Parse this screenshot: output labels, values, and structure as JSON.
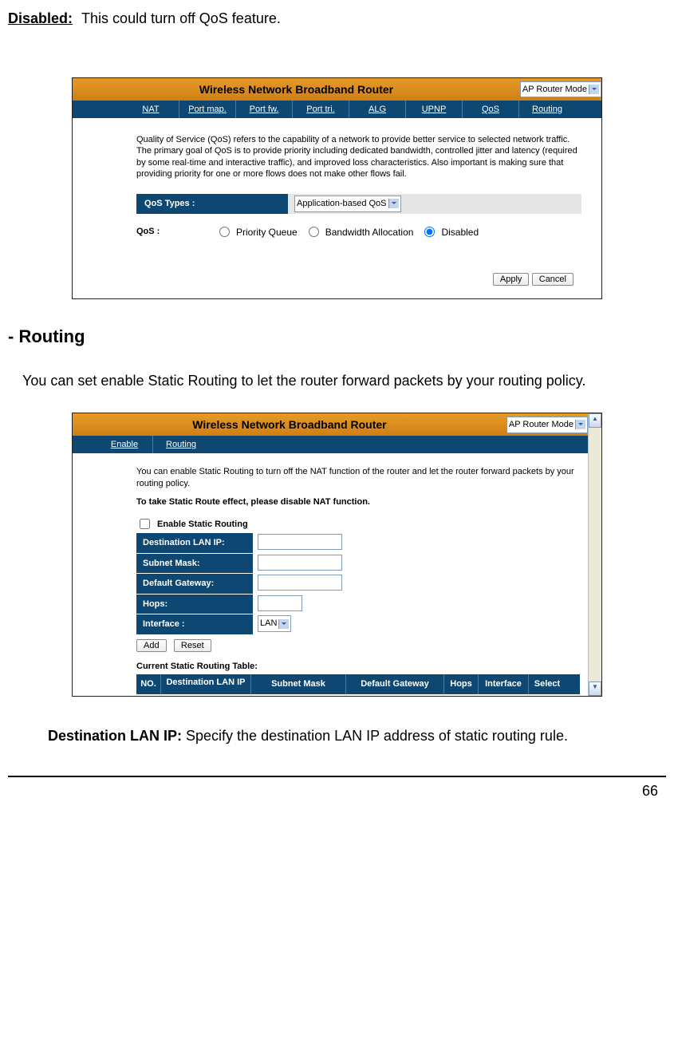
{
  "intro": {
    "disabled_label": "Disabled:",
    "disabled_text": "This could turn off QoS feature."
  },
  "qos": {
    "header_title": "Wireless Network Broadband Router",
    "mode": "AP Router Mode",
    "tabs": [
      "NAT",
      "Port map.",
      "Port fw.",
      "Port tri.",
      "ALG",
      "UPNP",
      "QoS",
      "Routing"
    ],
    "description": "Quality of Service (QoS) refers to the capability of a network to provide better service to selected network traffic. The primary goal of QoS is to provide priority including dedicated bandwidth, controlled jitter and latency (required by some real-time and interactive traffic), and improved loss characteristics. Also important is making sure that providing priority for one or more flows does not make other flows fail.",
    "types_label": "QoS Types :",
    "types_value": "Application-based QoS",
    "qos_label": "QoS :",
    "radio_priority": "Priority Queue",
    "radio_bandwidth": "Bandwidth Allocation",
    "radio_disabled": "Disabled",
    "btn_apply": "Apply",
    "btn_cancel": "Cancel"
  },
  "routing_section": {
    "title": "- Routing",
    "desc": "You can set enable Static Routing to let the router forward packets by your routing policy."
  },
  "routing": {
    "header_title": "Wireless Network Broadband Router",
    "mode": "AP Router Mode",
    "tabs": [
      "Enable",
      "Routing"
    ],
    "description": "You can enable Static Routing to turn off the NAT function of the router and let the router forward packets by your routing policy.",
    "note": "To take Static Route effect, please disable NAT function.",
    "enable_label": "Enable Static Routing",
    "dest_label": "Destination LAN IP:",
    "mask_label": "Subnet Mask:",
    "gw_label": "Default Gateway:",
    "hops_label": "Hops:",
    "if_label": "Interface :",
    "if_value": "LAN",
    "btn_add": "Add",
    "btn_reset": "Reset",
    "table_title": "Current Static Routing Table:",
    "th_no": "NO.",
    "th_ip": "Destination LAN IP",
    "th_mask": "Subnet Mask",
    "th_gw": "Default Gateway",
    "th_hops": "Hops",
    "th_if": "Interface",
    "th_sel": "Select"
  },
  "field_def": {
    "label": "Destination LAN IP:",
    "text": " Specify the destination LAN IP address of static routing rule."
  },
  "page_number": "66"
}
